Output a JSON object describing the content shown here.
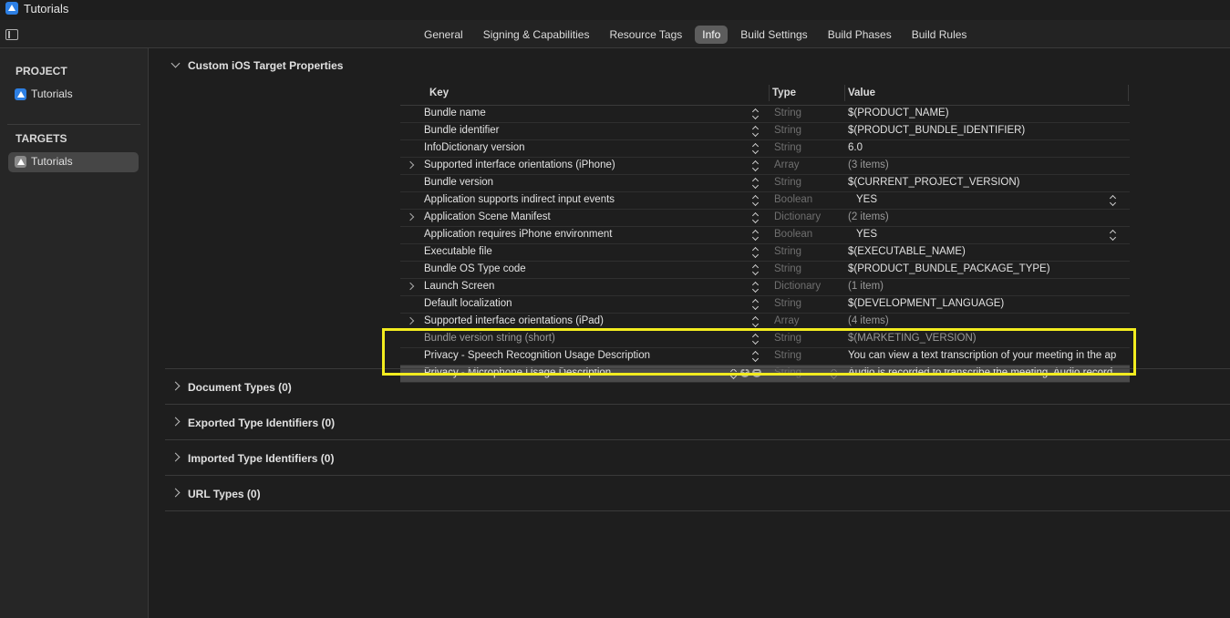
{
  "app": {
    "title": "Tutorials"
  },
  "tabs": [
    "General",
    "Signing & Capabilities",
    "Resource Tags",
    "Info",
    "Build Settings",
    "Build Phases",
    "Build Rules"
  ],
  "sidebar": {
    "project_header": "PROJECT",
    "project_item": "Tutorials",
    "targets_header": "TARGETS",
    "target_item": "Tutorials"
  },
  "sections": {
    "custom": "Custom iOS Target Properties",
    "document_types": "Document Types (0)",
    "exported": "Exported Type Identifiers (0)",
    "imported": "Imported Type Identifiers (0)",
    "url_types": "URL Types (0)"
  },
  "table": {
    "headers": {
      "key": "Key",
      "type": "Type",
      "value": "Value"
    },
    "rows": [
      {
        "key": "Bundle name",
        "type": "String",
        "value": "$(PRODUCT_NAME)"
      },
      {
        "key": "Bundle identifier",
        "type": "String",
        "value": "$(PRODUCT_BUNDLE_IDENTIFIER)"
      },
      {
        "key": "InfoDictionary version",
        "type": "String",
        "value": "6.0"
      },
      {
        "key": "Supported interface orientations (iPhone)",
        "type": "Array",
        "value": "(3 items)"
      },
      {
        "key": "Bundle version",
        "type": "String",
        "value": "$(CURRENT_PROJECT_VERSION)"
      },
      {
        "key": "Application supports indirect input events",
        "type": "Boolean",
        "value": "YES"
      },
      {
        "key": "Application Scene Manifest",
        "type": "Dictionary",
        "value": "(2 items)"
      },
      {
        "key": "Application requires iPhone environment",
        "type": "Boolean",
        "value": "YES"
      },
      {
        "key": "Executable file",
        "type": "String",
        "value": "$(EXECUTABLE_NAME)"
      },
      {
        "key": "Bundle OS Type code",
        "type": "String",
        "value": "$(PRODUCT_BUNDLE_PACKAGE_TYPE)"
      },
      {
        "key": "Launch Screen",
        "type": "Dictionary",
        "value": "(1 item)"
      },
      {
        "key": "Default localization",
        "type": "String",
        "value": "$(DEVELOPMENT_LANGUAGE)"
      },
      {
        "key": "Supported interface orientations (iPad)",
        "type": "Array",
        "value": "(4 items)"
      },
      {
        "key": "Bundle version string (short)",
        "type": "String",
        "value": "$(MARKETING_VERSION)"
      },
      {
        "key": "Privacy - Speech Recognition Usage Description",
        "type": "String",
        "value": "You can view a text transcription of your meeting in the ap"
      },
      {
        "key": "Privacy - Microphone Usage Description",
        "type": "String",
        "value": "Audio is recorded to transcribe the meeting. Audio record"
      }
    ]
  },
  "colors": {
    "highlight": "#f2ec1f",
    "accent": "#2d7fe3"
  }
}
